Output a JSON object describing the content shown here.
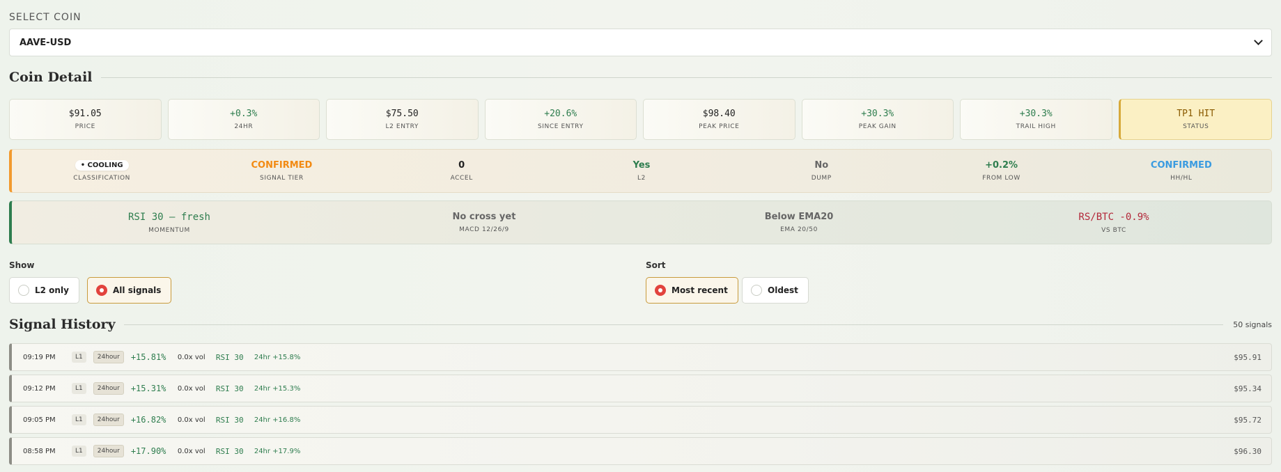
{
  "selector": {
    "label": "SELECT COIN",
    "value": "AAVE-USD"
  },
  "coin_detail": {
    "title": "Coin Detail",
    "stats": [
      {
        "value": "$91.05",
        "label": "PRICE"
      },
      {
        "value": "+0.3%",
        "label": "24HR"
      },
      {
        "value": "$75.50",
        "label": "L2 ENTRY"
      },
      {
        "value": "+20.6%",
        "label": "SINCE ENTRY"
      },
      {
        "value": "$98.40",
        "label": "PEAK PRICE"
      },
      {
        "value": "+30.3%",
        "label": "PEAK GAIN"
      },
      {
        "value": "+30.3%",
        "label": "TRAIL HIGH"
      },
      {
        "value": "TP1 HIT",
        "label": "STATUS"
      }
    ],
    "classification_row": [
      {
        "value": "• COOLING",
        "label": "CLASSIFICATION"
      },
      {
        "value": "CONFIRMED",
        "label": "SIGNAL TIER"
      },
      {
        "value": "0",
        "label": "ACCEL"
      },
      {
        "value": "Yes",
        "label": "L2"
      },
      {
        "value": "No",
        "label": "DUMP"
      },
      {
        "value": "+0.2%",
        "label": "FROM LOW"
      },
      {
        "value": "CONFIRMED",
        "label": "HH/HL"
      }
    ],
    "momentum_row": [
      {
        "value": "RSI 30 — fresh",
        "label": "MOMENTUM"
      },
      {
        "value": "No cross yet",
        "label": "MACD 12/26/9"
      },
      {
        "value": "Below EMA20",
        "label": "EMA 20/50"
      },
      {
        "value": "RS/BTC -0.9%",
        "label": "VS BTC"
      }
    ]
  },
  "filters": {
    "show_label": "Show",
    "show_options": [
      "L2 only",
      "All signals"
    ],
    "sort_label": "Sort",
    "sort_options": [
      "Most recent",
      "Oldest"
    ]
  },
  "signal_history": {
    "title": "Signal History",
    "count": "50 signals",
    "rows": [
      {
        "time": "09:19 PM",
        "level": "L1",
        "window": "24hour",
        "pct": "+15.81%",
        "vol": "0.0x vol",
        "rsi": "RSI 30",
        "h24": "24hr +15.8%",
        "price": "$95.91"
      },
      {
        "time": "09:12 PM",
        "level": "L1",
        "window": "24hour",
        "pct": "+15.31%",
        "vol": "0.0x vol",
        "rsi": "RSI 30",
        "h24": "24hr +15.3%",
        "price": "$95.34"
      },
      {
        "time": "09:05 PM",
        "level": "L1",
        "window": "24hour",
        "pct": "+16.82%",
        "vol": "0.0x vol",
        "rsi": "RSI 30",
        "h24": "24hr +16.8%",
        "price": "$95.72"
      },
      {
        "time": "08:58 PM",
        "level": "L1",
        "window": "24hour",
        "pct": "+17.90%",
        "vol": "0.0x vol",
        "rsi": "RSI 30",
        "h24": "24hr +17.9%",
        "price": "$96.30"
      }
    ]
  },
  "colors": {
    "accent_orange": "#f29a2e",
    "accent_green": "#2e7d4e",
    "radio_on": "#e2433d",
    "status_bg": "#fbf0c4"
  }
}
